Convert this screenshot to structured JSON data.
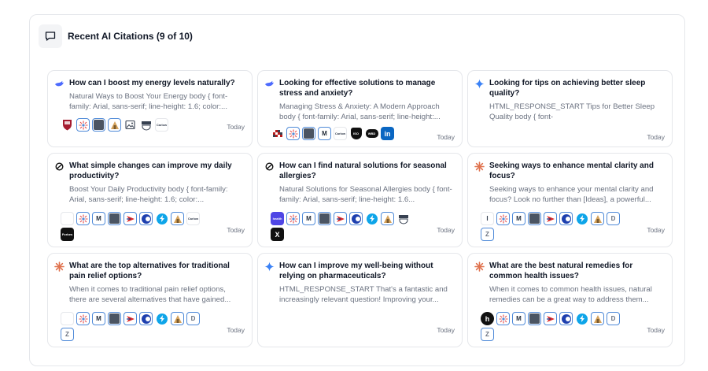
{
  "header": {
    "title": "Recent AI Citations (9 of 10)",
    "icon": "message-square-icon"
  },
  "colors": {
    "accent_border": "#4f8ad8",
    "card_border": "#e5e7eb",
    "muted_text": "#6b7280"
  },
  "cards": [
    {
      "question": "How can I boost my energy levels naturally?",
      "snippet": "Natural Ways to Boost Your Energy body { font-family: Arial, sans-serif; line-height: 1.6; color:...",
      "date": "Today",
      "engine_icon": "whale-icon",
      "sources": [
        {
          "icon": "harvard-shield-icon",
          "text": ""
        },
        {
          "icon": "sunburst-icon",
          "text": ""
        },
        {
          "icon": "gray-logo-icon",
          "text": ""
        },
        {
          "icon": "house-icon",
          "text": ""
        },
        {
          "icon": "image-icon",
          "text": ""
        },
        {
          "icon": "crest-icon",
          "text": ""
        },
        {
          "icon": "wordmark-icon",
          "text": "Carlow"
        }
      ]
    },
    {
      "question": "Looking for effective solutions to manage stress and anxiety?",
      "snippet": "Managing Stress & Anxiety: A Modern Approach body { font-family: Arial, sans-serif; line-height:...",
      "date": "Today",
      "engine_icon": "whale-icon",
      "sources": [
        {
          "icon": "checker-icon",
          "text": ""
        },
        {
          "icon": "sunburst-icon",
          "text": ""
        },
        {
          "icon": "gray-logo-icon",
          "text": ""
        },
        {
          "icon": "m-logo-icon",
          "text": "M"
        },
        {
          "icon": "wordmark-icon",
          "text": "Carlow"
        },
        {
          "icon": "shield-dark-icon",
          "text": "ISO"
        },
        {
          "icon": "pill-dark-icon",
          "text": "WBD"
        },
        {
          "icon": "linkedin-icon",
          "text": "in"
        }
      ]
    },
    {
      "question": "Looking for tips on achieving better sleep quality?",
      "snippet": "HTML_RESPONSE_START Tips for Better Sleep Quality body { font-",
      "date": "Today",
      "engine_icon": "sparkle-icon",
      "sources": []
    },
    {
      "question": "What simple changes can improve my daily productivity?",
      "snippet": "Boost Your Daily Productivity body { font-family: Arial, sans-serif; line-height: 1.6; color:...",
      "date": "Today",
      "engine_icon": "openai-icon",
      "sources": [
        {
          "icon": "blank-icon",
          "text": ""
        },
        {
          "icon": "sunburst-icon",
          "text": ""
        },
        {
          "icon": "m-logo-icon",
          "text": "M"
        },
        {
          "icon": "gray-logo-icon",
          "text": ""
        },
        {
          "icon": "chevron-red-icon",
          "text": ""
        },
        {
          "icon": "c-logo-icon",
          "text": ""
        },
        {
          "icon": "bolt-icon",
          "text": ""
        },
        {
          "icon": "house-icon",
          "text": ""
        },
        {
          "icon": "wordmark-icon",
          "text": "Carlow"
        },
        {
          "icon": "dark-square-icon",
          "text": "Forbes"
        }
      ]
    },
    {
      "question": "How can I find natural solutions for seasonal allergies?",
      "snippet": "Natural Solutions for Seasonal Allergies body { font-family: Arial, sans-serif; line-height: 1.6...",
      "date": "Today",
      "engine_icon": "openai-icon",
      "sources": [
        {
          "icon": "blue-square-icon",
          "text": "health"
        },
        {
          "icon": "sunburst-icon",
          "text": ""
        },
        {
          "icon": "m-logo-icon",
          "text": "M"
        },
        {
          "icon": "gray-logo-icon",
          "text": ""
        },
        {
          "icon": "chevron-red-icon",
          "text": ""
        },
        {
          "icon": "c-logo-icon",
          "text": ""
        },
        {
          "icon": "bolt-icon",
          "text": ""
        },
        {
          "icon": "house-icon",
          "text": ""
        },
        {
          "icon": "crest-icon",
          "text": ""
        },
        {
          "icon": "x-logo-icon",
          "text": "X"
        }
      ]
    },
    {
      "question": "Seeking ways to enhance mental clarity and focus?",
      "snippet": "Seeking ways to enhance your mental clarity and focus? Look no further than [Ideas], a powerful...",
      "date": "Today",
      "engine_icon": "asterisk-icon",
      "sources": [
        {
          "icon": "i-logo-icon",
          "text": "I"
        },
        {
          "icon": "sunburst-icon",
          "text": ""
        },
        {
          "icon": "m-logo-icon",
          "text": "M"
        },
        {
          "icon": "gray-logo-icon",
          "text": ""
        },
        {
          "icon": "chevron-red-icon",
          "text": ""
        },
        {
          "icon": "c-logo-icon",
          "text": ""
        },
        {
          "icon": "bolt-icon",
          "text": ""
        },
        {
          "icon": "house-icon",
          "text": ""
        },
        {
          "icon": "d-logo-icon",
          "text": "D"
        },
        {
          "icon": "z-logo-icon",
          "text": "Z"
        }
      ]
    },
    {
      "question": "What are the top alternatives for traditional pain relief options?",
      "snippet": "When it comes to traditional pain relief options, there are several alternatives that have gained...",
      "date": "Today",
      "engine_icon": "asterisk-icon",
      "sources": [
        {
          "icon": "blank-icon",
          "text": ""
        },
        {
          "icon": "sunburst-icon",
          "text": ""
        },
        {
          "icon": "m-logo-icon",
          "text": "M"
        },
        {
          "icon": "gray-logo-icon",
          "text": ""
        },
        {
          "icon": "chevron-red-icon",
          "text": ""
        },
        {
          "icon": "c-logo-icon",
          "text": ""
        },
        {
          "icon": "bolt-icon",
          "text": ""
        },
        {
          "icon": "house-icon",
          "text": ""
        },
        {
          "icon": "d-logo-icon",
          "text": "D"
        },
        {
          "icon": "z-logo-icon",
          "text": "Z"
        }
      ]
    },
    {
      "question": "How can I improve my well-being without relying on pharmaceuticals?",
      "snippet": "HTML_RESPONSE_START That's a fantastic and increasingly relevant question! Improving your...",
      "date": "Today",
      "engine_icon": "sparkle-icon",
      "sources": []
    },
    {
      "question": "What are the best natural remedies for common health issues?",
      "snippet": "When it comes to common health issues, natural remedies can be a great way to address them...",
      "date": "Today",
      "engine_icon": "asterisk-icon",
      "sources": [
        {
          "icon": "h-logo-icon",
          "text": "h"
        },
        {
          "icon": "sunburst-icon",
          "text": ""
        },
        {
          "icon": "m-logo-icon",
          "text": "M"
        },
        {
          "icon": "gray-logo-icon",
          "text": ""
        },
        {
          "icon": "chevron-red-icon",
          "text": ""
        },
        {
          "icon": "c-logo-icon",
          "text": ""
        },
        {
          "icon": "bolt-icon",
          "text": ""
        },
        {
          "icon": "house-icon",
          "text": ""
        },
        {
          "icon": "d-logo-icon",
          "text": "D"
        },
        {
          "icon": "z-logo-icon",
          "text": "Z"
        }
      ]
    }
  ]
}
